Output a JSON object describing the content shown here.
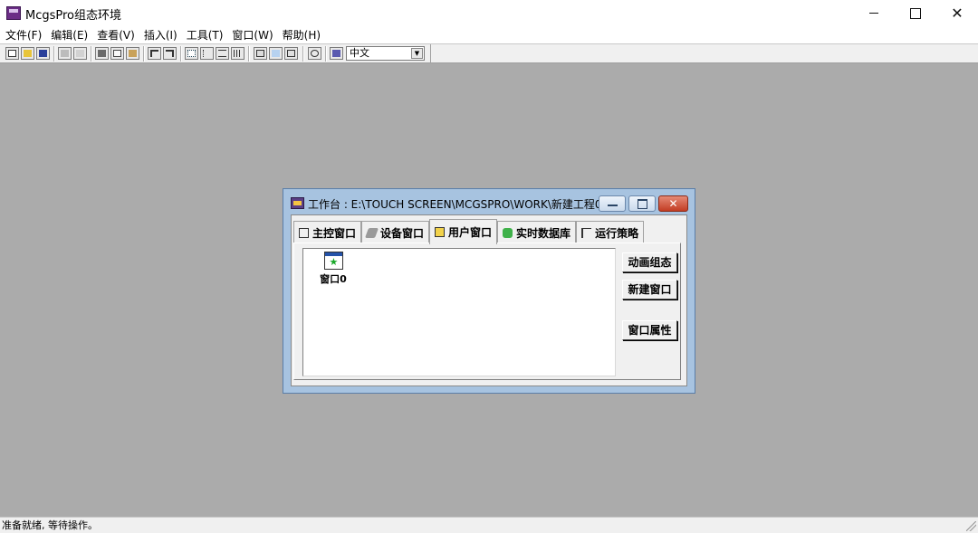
{
  "app": {
    "title": "McgsPro组态环境"
  },
  "menu": [
    "文件(F)",
    "编辑(E)",
    "查看(V)",
    "插入(I)",
    "工具(T)",
    "窗口(W)",
    "帮助(H)"
  ],
  "toolbar": {
    "language": "中文"
  },
  "workspace": {
    "title": "工作台 : E:\\TOUCH SCREEN\\MCGSPRO\\WORK\\新建工程0....",
    "close_glyph": "✕",
    "tabs": [
      "主控窗口",
      "设备窗口",
      "用户窗口",
      "实时数据库",
      "运行策略"
    ],
    "active_tab": "用户窗口",
    "items": [
      {
        "label": "窗口0"
      }
    ],
    "buttons": {
      "animate": "动画组态",
      "new_window": "新建窗口",
      "window_props": "窗口属性"
    }
  },
  "status": {
    "text": "准备就绪, 等待操作。"
  },
  "colors": {
    "workspace_bg": "#ababab",
    "window_frame": "#a7c3e0",
    "close_red": "#c33d24"
  }
}
